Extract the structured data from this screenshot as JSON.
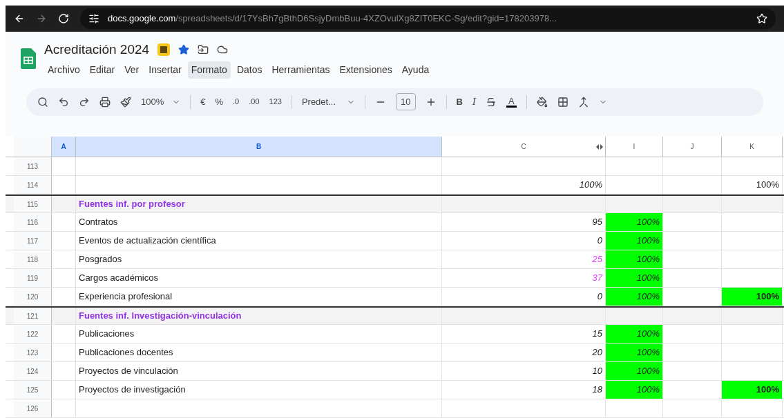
{
  "browser": {
    "url_domain": "docs.google.com",
    "url_path": "/spreadsheets/d/17YsBh7gBthD6SsjyDmbBuu-4XZOvulXg8ZIT0EKC-Sg/edit?gid=178203978..."
  },
  "document": {
    "title": "Acreditación 2024",
    "starred": true
  },
  "menu": [
    {
      "label": "Archivo",
      "selected": false
    },
    {
      "label": "Editar",
      "selected": false
    },
    {
      "label": "Ver",
      "selected": false
    },
    {
      "label": "Insertar",
      "selected": false
    },
    {
      "label": "Formato",
      "selected": true
    },
    {
      "label": "Datos",
      "selected": false
    },
    {
      "label": "Herramientas",
      "selected": false
    },
    {
      "label": "Extensiones",
      "selected": false
    },
    {
      "label": "Ayuda",
      "selected": false
    }
  ],
  "toolbar": {
    "zoom": "100%",
    "currency": "€",
    "percent": "%",
    "decrease_decimals": ".0",
    "increase_decimals": ".00",
    "number_format": "123",
    "font": "Predet...",
    "font_size": "10",
    "bold": "B",
    "italic": "I",
    "text_color": "A"
  },
  "columns": [
    {
      "label": "A",
      "selected": true
    },
    {
      "label": "B",
      "selected": true
    },
    {
      "label": "C",
      "selected": false
    },
    {
      "label": "I",
      "selected": false
    },
    {
      "label": "J",
      "selected": false
    },
    {
      "label": "K",
      "selected": false
    }
  ],
  "rows": [
    {
      "number": "113",
      "kind": "blank"
    },
    {
      "number": "114",
      "kind": "item",
      "b": "",
      "c": {
        "text": "100%",
        "italic": true
      },
      "k": {
        "text": "100%"
      }
    },
    {
      "number": "115",
      "kind": "section",
      "b": "Fuentes inf. por profesor"
    },
    {
      "number": "116",
      "kind": "item",
      "b": "Contratos",
      "c": {
        "text": "95",
        "italic": true
      },
      "i": {
        "text": "100%",
        "italic": true,
        "filled": true
      }
    },
    {
      "number": "117",
      "kind": "item",
      "b": "Eventos de actualización científica",
      "c": {
        "text": "0",
        "italic": true
      },
      "i": {
        "text": "100%",
        "italic": true,
        "filled": true
      }
    },
    {
      "number": "118",
      "kind": "item",
      "b": "Posgrados",
      "c": {
        "text": "25",
        "italic": true,
        "color": "#e040fb"
      },
      "i": {
        "text": "100%",
        "italic": true,
        "filled": true
      }
    },
    {
      "number": "119",
      "kind": "item",
      "b": "Cargos académicos",
      "c": {
        "text": "37",
        "italic": true,
        "color": "#e040fb"
      },
      "i": {
        "text": "100%",
        "italic": true,
        "filled": true
      }
    },
    {
      "number": "120",
      "kind": "item",
      "b": "Experiencia profesional",
      "c": {
        "text": "0",
        "italic": true
      },
      "i": {
        "text": "100%",
        "italic": true,
        "filled": true
      },
      "k": {
        "text": "100%",
        "bold": true,
        "filled": true
      }
    },
    {
      "number": "121",
      "kind": "section",
      "b": "Fuentes inf. Investigación-vinculación"
    },
    {
      "number": "122",
      "kind": "item",
      "b": "Publicaciones",
      "c": {
        "text": "15",
        "italic": true
      },
      "i": {
        "text": "100%",
        "italic": true,
        "filled": true
      }
    },
    {
      "number": "123",
      "kind": "item",
      "b": "Publicaciones docentes",
      "c": {
        "text": "20",
        "italic": true
      },
      "i": {
        "text": "100%",
        "italic": true,
        "filled": true
      }
    },
    {
      "number": "124",
      "kind": "item",
      "b": "Proyectos de vinculación",
      "c": {
        "text": "10",
        "italic": true
      },
      "i": {
        "text": "100%",
        "italic": true,
        "filled": true
      }
    },
    {
      "number": "125",
      "kind": "item",
      "b": "Proyectos de investigación",
      "c": {
        "text": "18",
        "italic": true
      },
      "i": {
        "text": "100%",
        "italic": true,
        "filled": true
      },
      "k": {
        "text": "100%",
        "bold": true,
        "filled": true
      }
    },
    {
      "number": "126",
      "kind": "blank"
    }
  ]
}
